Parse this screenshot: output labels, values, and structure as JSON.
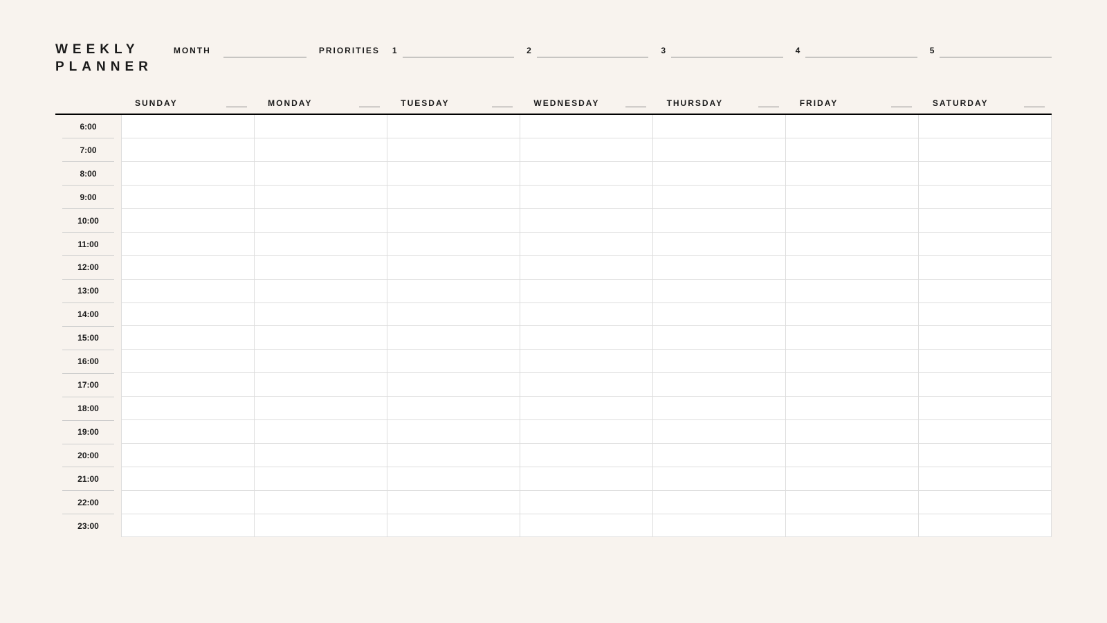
{
  "header": {
    "title_line1": "WEEKLY",
    "title_line2": "PLANNER",
    "month_label": "MONTH",
    "month_value": "",
    "priorities_label": "PRIORITIES",
    "priorities": [
      {
        "num": "1",
        "value": ""
      },
      {
        "num": "2",
        "value": ""
      },
      {
        "num": "3",
        "value": ""
      },
      {
        "num": "4",
        "value": ""
      },
      {
        "num": "5",
        "value": ""
      }
    ]
  },
  "days": [
    {
      "name": "SUNDAY",
      "date": ""
    },
    {
      "name": "MONDAY",
      "date": ""
    },
    {
      "name": "TUESDAY",
      "date": ""
    },
    {
      "name": "WEDNESDAY",
      "date": ""
    },
    {
      "name": "THURSDAY",
      "date": ""
    },
    {
      "name": "FRIDAY",
      "date": ""
    },
    {
      "name": "SATURDAY",
      "date": ""
    }
  ],
  "hours": [
    "6:00",
    "7:00",
    "8:00",
    "9:00",
    "10:00",
    "11:00",
    "12:00",
    "13:00",
    "14:00",
    "15:00",
    "16:00",
    "17:00",
    "18:00",
    "19:00",
    "20:00",
    "21:00",
    "22:00",
    "23:00"
  ]
}
